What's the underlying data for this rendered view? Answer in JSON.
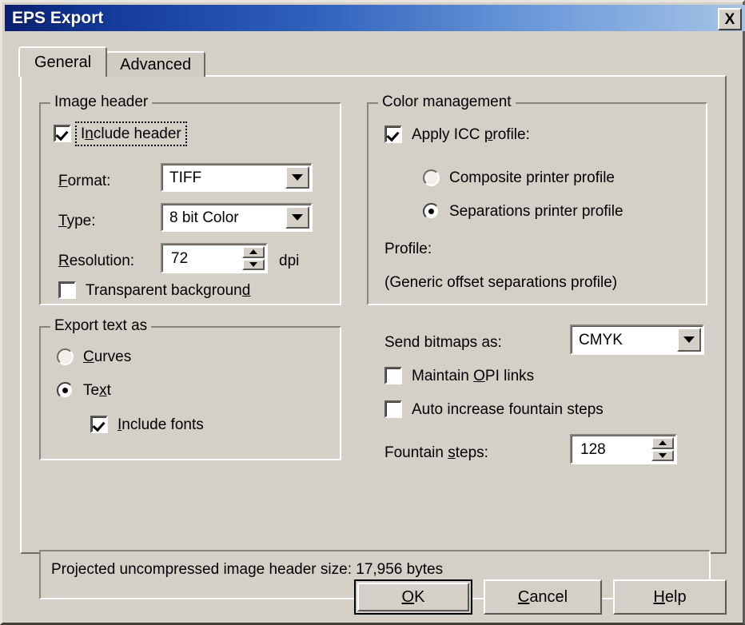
{
  "window": {
    "title": "EPS Export",
    "close_icon": "close-icon",
    "close_label": "X"
  },
  "tabs": [
    {
      "label": "General",
      "active": true
    },
    {
      "label": "Advanced",
      "active": false
    }
  ],
  "image_header": {
    "group_label": "Image header",
    "include_header": {
      "label": "Include header",
      "checked": true,
      "accel_index": 4,
      "focused": true
    },
    "format": {
      "label": "Format:",
      "accel_index": 0,
      "value": "TIFF"
    },
    "type": {
      "label": "Type:",
      "accel_index": 0,
      "value": "8 bit Color"
    },
    "resolution": {
      "label": "Resolution:",
      "accel_index": 0,
      "value": "72",
      "unit": "dpi"
    },
    "transparent_background": {
      "label": "Transparent background",
      "checked": false,
      "accel_index": 12
    }
  },
  "color_management": {
    "group_label": "Color management",
    "apply_icc": {
      "label": "Apply ICC profile:",
      "checked": true,
      "accel_index": 10
    },
    "composite": {
      "label": "Composite printer profile",
      "selected": false
    },
    "separations": {
      "label": "Separations printer profile",
      "selected": true
    },
    "profile_label": "Profile:",
    "profile_value": "(Generic offset separations profile)"
  },
  "export_text_as": {
    "group_label": "Export text as",
    "curves": {
      "label": "Curves",
      "selected": false,
      "accel_index": 0
    },
    "text": {
      "label": "Text",
      "selected": true,
      "accel_index": 2
    },
    "include_fonts": {
      "label": "Include fonts",
      "checked": true,
      "accel_index": 0
    }
  },
  "bitmap_options": {
    "send_bitmaps_label": "Send bitmaps as:",
    "send_bitmaps_value": "CMYK",
    "maintain_opi": {
      "label": "Maintain OPI links",
      "checked": false,
      "accel_index": 9
    },
    "auto_increase": {
      "label": "Auto increase fountain steps",
      "checked": false
    },
    "fountain_steps": {
      "label": "Fountain steps:",
      "accel_index": 9,
      "value": "128"
    }
  },
  "status": {
    "text": "Projected uncompressed image header size: 17,956 bytes"
  },
  "buttons": {
    "ok": {
      "label": "OK",
      "accel_index": 0,
      "default": true
    },
    "cancel": {
      "label": "Cancel",
      "accel_index": 0
    },
    "help": {
      "label": "Help",
      "accel_index": 0
    }
  },
  "colors": {
    "dialog_face": "#d4d0c8",
    "title_start": "#0a1f6e",
    "title_end": "#a6c3e6",
    "field_bg": "#ffffff",
    "text": "#000000"
  }
}
